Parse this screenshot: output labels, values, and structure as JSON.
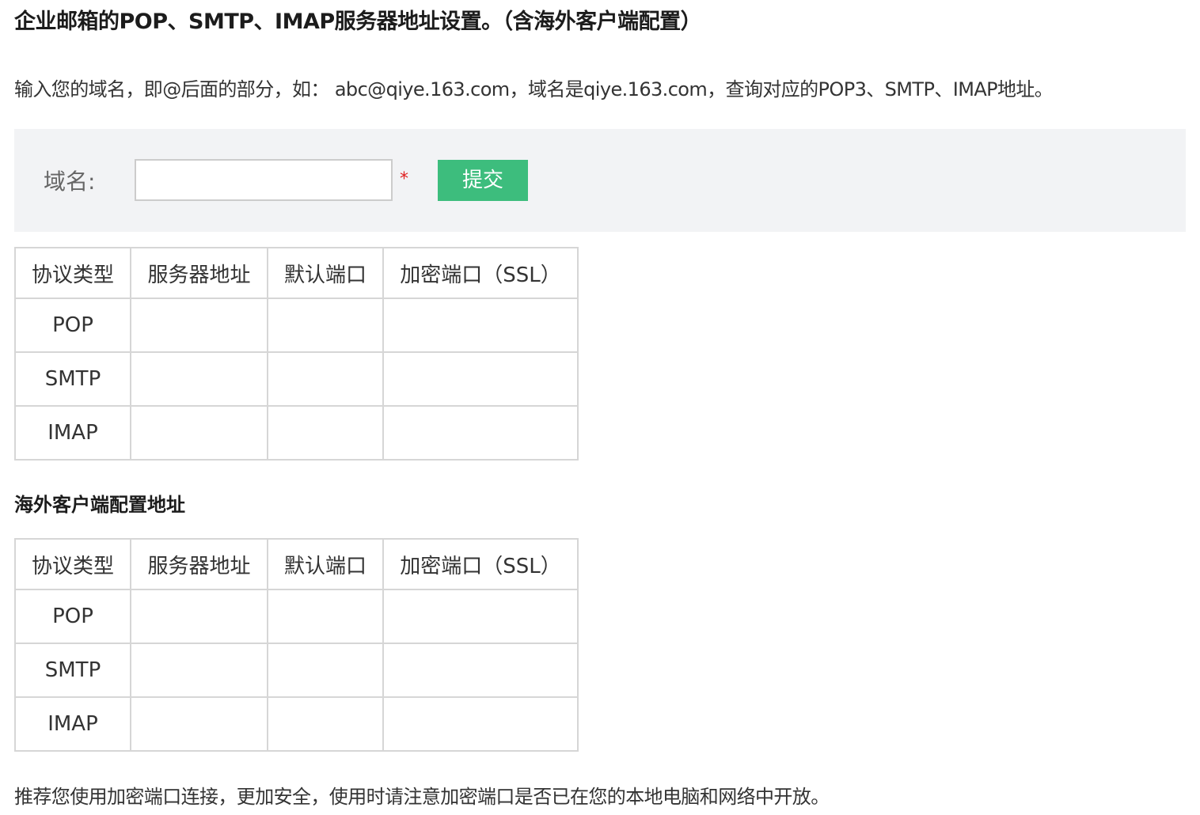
{
  "header": {
    "title": "企业邮箱的POP、SMTP、IMAP服务器地址设置。（含海外客户端配置）"
  },
  "intro": {
    "text": "输入您的域名，即@后面的部分，如： abc@qiye.163.com，域名是qiye.163.com，查询对应的POP3、SMTP、IMAP地址。"
  },
  "form": {
    "domain_label": "域名:",
    "domain_value": "",
    "domain_placeholder": "",
    "required_mark": "*",
    "submit_label": "提交",
    "submit_color": "#3dbd7d",
    "panel_color": "#f2f3f5"
  },
  "domestic_table": {
    "headers": [
      "协议类型",
      "服务器地址",
      "默认端口",
      "加密端口（SSL）"
    ],
    "rows": [
      [
        "POP",
        "",
        "",
        ""
      ],
      [
        "SMTP",
        "",
        "",
        ""
      ],
      [
        "IMAP",
        "",
        "",
        ""
      ]
    ]
  },
  "overseas_section": {
    "heading": "海外客户端配置地址"
  },
  "overseas_table": {
    "headers": [
      "协议类型",
      "服务器地址",
      "默认端口",
      "加密端口（SSL）"
    ],
    "rows": [
      [
        "POP",
        "",
        "",
        ""
      ],
      [
        "SMTP",
        "",
        "",
        ""
      ],
      [
        "IMAP",
        "",
        "",
        ""
      ]
    ]
  },
  "footer": {
    "note": "推荐您使用加密端口连接，更加安全，使用时请注意加密端口是否已在您的本地电脑和网络中开放。"
  }
}
